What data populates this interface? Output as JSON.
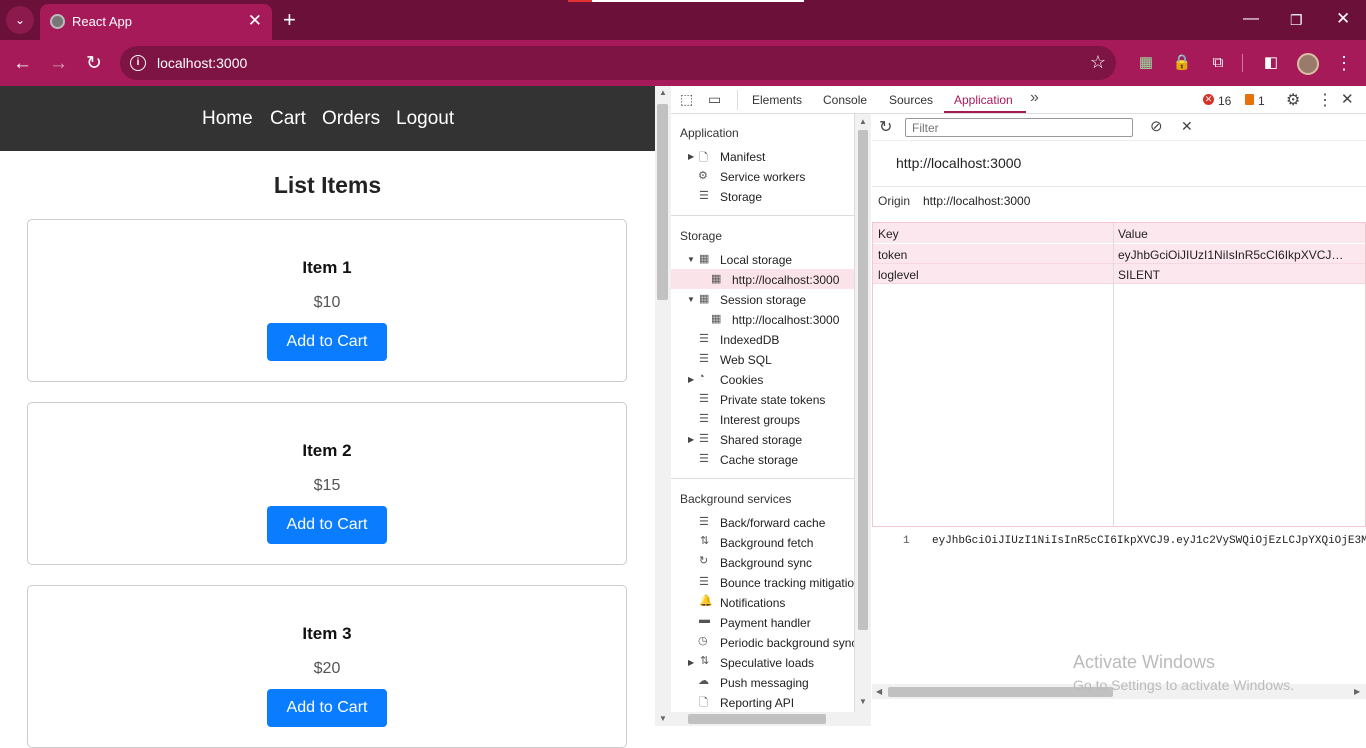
{
  "browser": {
    "tab_title": "React App",
    "close_tab_glyph": "✕",
    "new_tab_glyph": "+",
    "url": "localhost:3000",
    "accent": "#a71a5a",
    "frame_color": "#6b1038"
  },
  "app": {
    "nav": [
      "Home",
      "Cart",
      "Orders",
      "Logout"
    ],
    "page_title": "List Items",
    "items": [
      {
        "name": "Item 1",
        "price": "$10",
        "button": "Add to Cart"
      },
      {
        "name": "Item 2",
        "price": "$15",
        "button": "Add to Cart"
      },
      {
        "name": "Item 3",
        "price": "$20",
        "button": "Add to Cart"
      }
    ],
    "button_color": "#0a7cff"
  },
  "devtools": {
    "tabs": [
      "Elements",
      "Console",
      "Sources",
      "Application"
    ],
    "active_tab": "Application",
    "errors": "16",
    "warnings": "1",
    "sidebar": {
      "application_header": "Application",
      "application_items": [
        "Manifest",
        "Service workers",
        "Storage"
      ],
      "storage_header": "Storage",
      "local_storage": "Local storage",
      "local_storage_child": "http://localhost:3000",
      "session_storage": "Session storage",
      "session_storage_child": "http://localhost:3000",
      "storage_items": [
        "IndexedDB",
        "Web SQL",
        "Cookies",
        "Private state tokens",
        "Interest groups",
        "Shared storage",
        "Cache storage"
      ],
      "background_header": "Background services",
      "background_items": [
        "Back/forward cache",
        "Background fetch",
        "Background sync",
        "Bounce tracking mitigatio",
        "Notifications",
        "Payment handler",
        "Periodic background sync",
        "Speculative loads",
        "Push messaging",
        "Reporting API"
      ]
    },
    "filter_placeholder": "Filter",
    "origin_title": "http://localhost:3000",
    "origin_label": "Origin",
    "origin_value": "http://localhost:3000",
    "columns": [
      "Key",
      "Value"
    ],
    "rows": [
      {
        "key": "token",
        "value": "eyJhbGciOiJIUzI1NiIsInR5cCI6IkpXVCJ9.ey..."
      },
      {
        "key": "loglevel",
        "value": "SILENT"
      }
    ],
    "preview_line_number": "1",
    "preview_value": "eyJhbGciOiJIUzI1NiIsInR5cCI6IkpXVCJ9.eyJ1c2VySWQiOjEzLCJpYXQiOjE3M"
  },
  "os": {
    "watermark_title": "Activate Windows",
    "watermark_sub": "Go to Settings to activate Windows."
  }
}
